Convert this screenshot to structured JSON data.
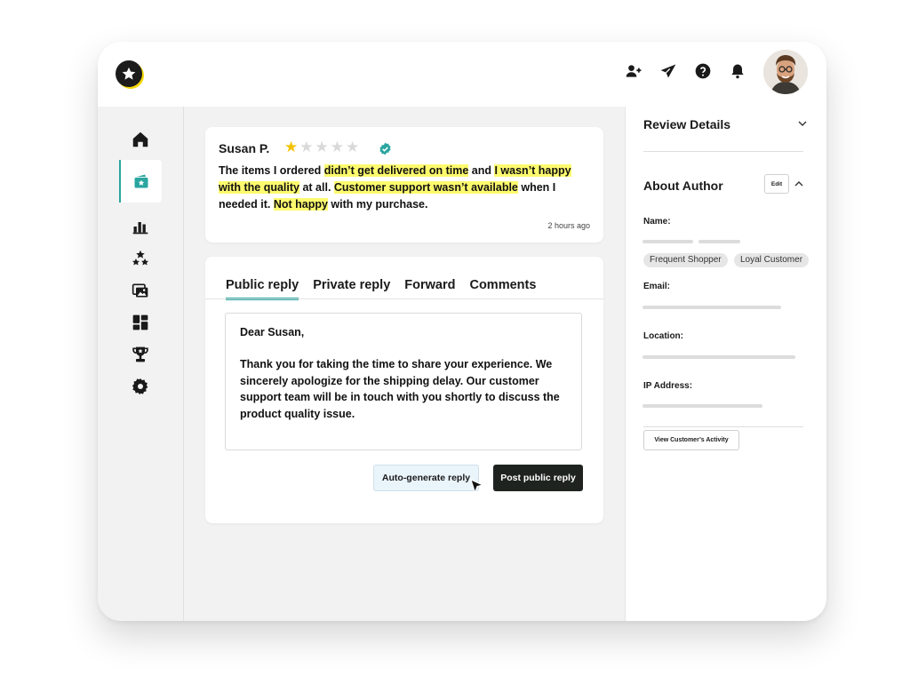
{
  "header": {
    "icons": [
      "add-user-icon",
      "send-icon",
      "help-icon",
      "bell-icon"
    ],
    "avatar": "avatar"
  },
  "sidebar": {
    "items": [
      {
        "icon": "home-icon"
      },
      {
        "icon": "reviews-icon",
        "active": true
      },
      {
        "icon": "analytics-icon"
      },
      {
        "icon": "ratings-icon"
      },
      {
        "icon": "media-icon"
      },
      {
        "icon": "dashboard-icon"
      },
      {
        "icon": "trophy-icon"
      },
      {
        "icon": "settings-icon"
      }
    ]
  },
  "review": {
    "author": "Susan P.",
    "rating": 1,
    "max_rating": 5,
    "segments": [
      {
        "text": "The items I ordered ",
        "hl": false
      },
      {
        "text": "didn’t get delivered on time",
        "hl": true
      },
      {
        "text": " and ",
        "hl": false
      },
      {
        "text": "I wasn’t happy with the quality",
        "hl": true
      },
      {
        "text": " at all. ",
        "hl": false
      },
      {
        "text": "Customer support wasn’t available",
        "hl": true
      },
      {
        "text": " when I needed it. ",
        "hl": false
      },
      {
        "text": "Not happy",
        "hl": true
      },
      {
        "text": " with my purchase.",
        "hl": false
      }
    ],
    "time": "2 hours ago"
  },
  "reply": {
    "tabs": [
      "Public reply",
      "Private reply",
      "Forward",
      "Comments"
    ],
    "active_tab": 0,
    "greeting": "Dear Susan,",
    "body": "Thank you for taking the time to share your experience. We sincerely apologize for the shipping delay. Our customer support team will be in touch with you shortly to discuss the product quality issue.",
    "auto_label": "Auto-generate reply",
    "post_label": "Post public reply"
  },
  "details": {
    "review_details": "Review Details",
    "about_author": "About Author",
    "edit": "Edit",
    "name_label": "Name:",
    "tags": [
      "Frequent Shopper",
      "Loyal Customer"
    ],
    "email_label": "Email:",
    "location_label": "Location:",
    "ip_label": "IP Address:",
    "activity_btn": "View Customer’s Activity"
  },
  "colors": {
    "accent": "#2aa5a0",
    "highlight": "#fdfa6e",
    "star": "#f2c200",
    "dark_button": "#1e2320"
  }
}
